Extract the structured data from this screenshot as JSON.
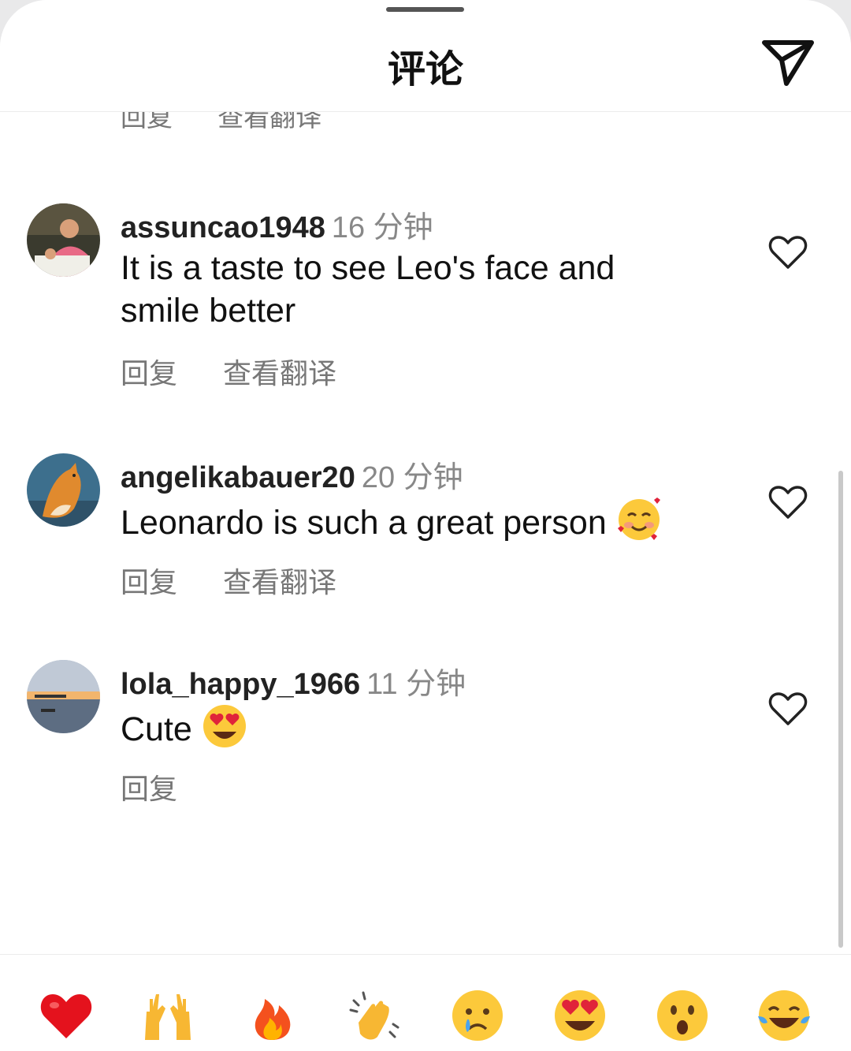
{
  "header": {
    "title": "评论",
    "share_icon": "send-icon"
  },
  "actions": {
    "reply": "回复",
    "translate": "查看翻译"
  },
  "comments": [
    {
      "username": "assuncao1948",
      "time": "16 分钟",
      "text": "It is a taste to see Leo's face and smile better",
      "has_translate": true
    },
    {
      "username": "angelikabauer20",
      "time": "20 分钟",
      "text": "Leonardo is such a great person",
      "emoji": "smiling-face-with-hearts",
      "has_translate": true
    },
    {
      "username": "lola_happy_1966",
      "time": "11 分钟",
      "text": "Cute",
      "emoji": "heart-eyes",
      "has_translate": false
    }
  ],
  "reaction_bar": [
    "red-heart",
    "raising-hands",
    "fire",
    "clapping-hands",
    "crying-face",
    "heart-eyes",
    "surprised-face",
    "tears-of-joy"
  ],
  "colors": {
    "text": "#111111",
    "muted": "#777777",
    "like_outline": "#222222"
  }
}
